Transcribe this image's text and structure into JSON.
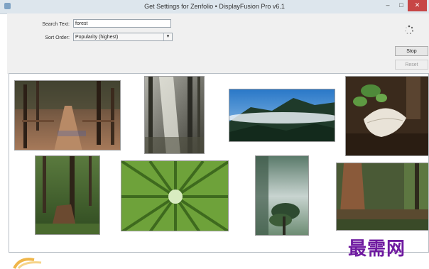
{
  "window": {
    "title": "Get Settings for Zenfolio • DisplayFusion Pro v6.1",
    "minimize_glyph": "–",
    "maximize_glyph": "□",
    "close_glyph": "✕"
  },
  "search": {
    "label": "Search Text:",
    "value": "forest"
  },
  "sort": {
    "label": "Sort Order:",
    "selected": "Popularity (highest)"
  },
  "buttons": {
    "stop": "Stop",
    "reset": "Reset"
  },
  "icons": {
    "app": "app-icon",
    "loading": "loading-spinner-icon",
    "dropdown": "chevron-down-icon"
  },
  "thumbnails": [
    {
      "name": "forest-path-bridge"
    },
    {
      "name": "sunbeam-forest"
    },
    {
      "name": "misty-mountains"
    },
    {
      "name": "mushroom-closeup"
    },
    {
      "name": "tree-stump-forest"
    },
    {
      "name": "bamboo-canopy"
    },
    {
      "name": "misty-tree"
    },
    {
      "name": "redwood-trunk"
    }
  ],
  "watermark": "最需网"
}
